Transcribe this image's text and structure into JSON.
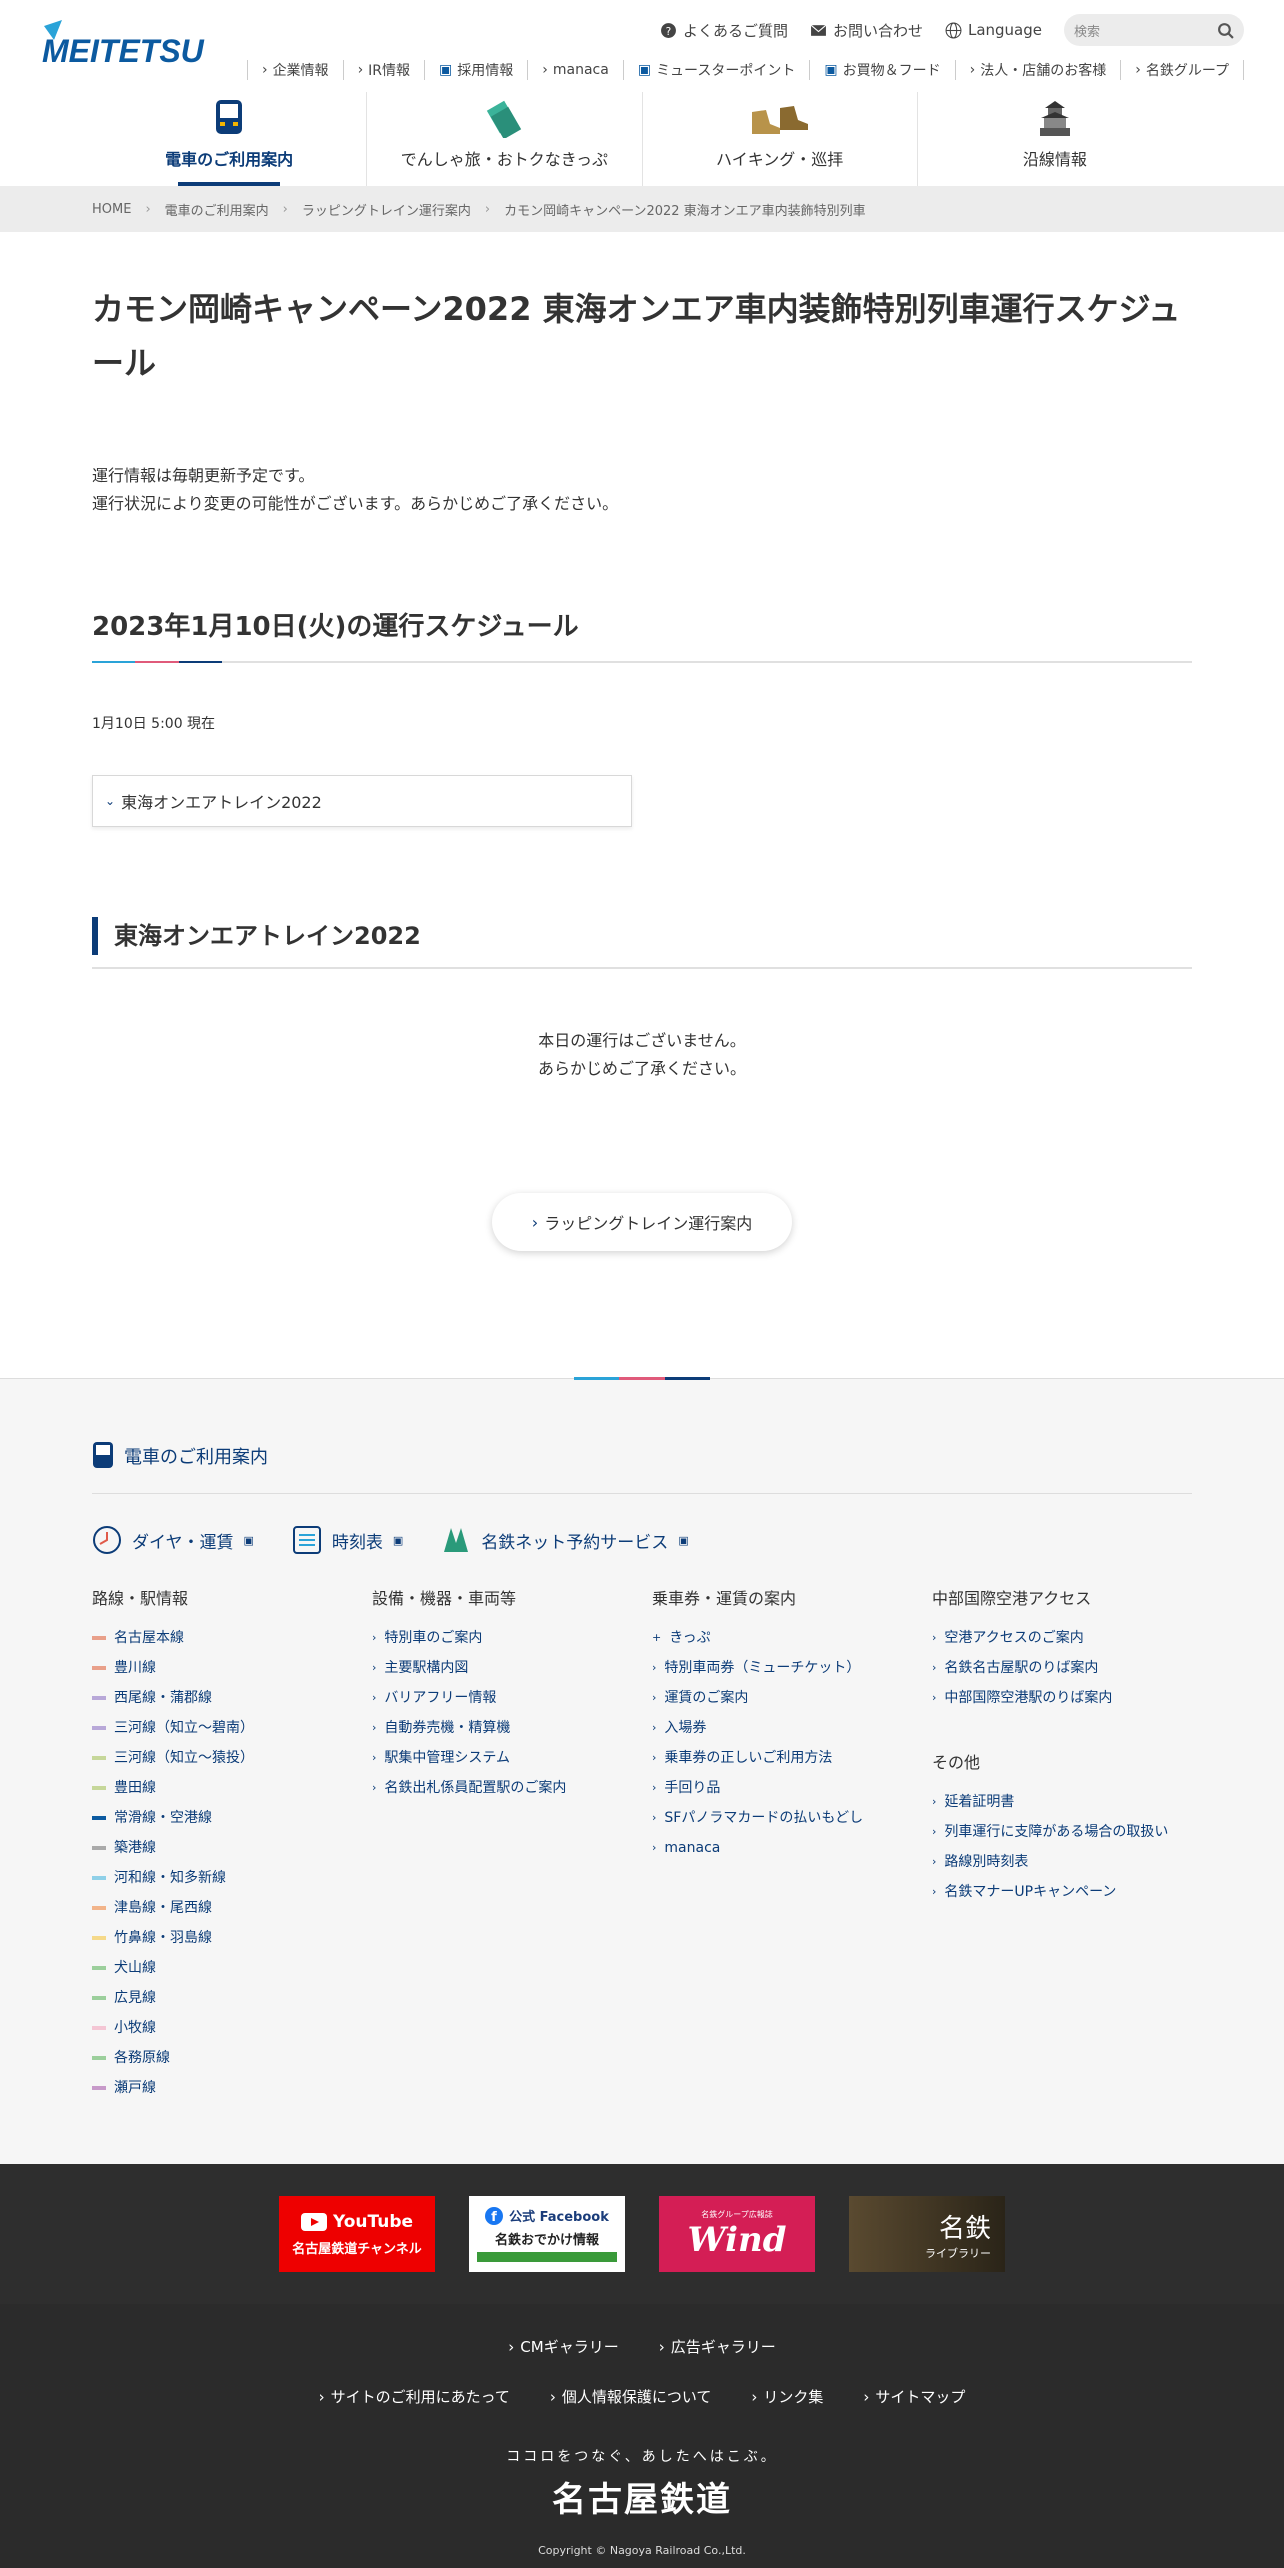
{
  "header": {
    "logo": "MEITETSU",
    "util": {
      "faq": "よくあるご質問",
      "contact": "お問い合わせ",
      "language": "Language",
      "search_placeholder": "検索"
    },
    "subnav": [
      "企業情報",
      "IR情報",
      "採用情報",
      "manaca",
      "ミュースターポイント",
      "お買物＆フード",
      "法人・店舗のお客様",
      "名鉄グループ"
    ],
    "gnav": [
      "電車のご利用案内",
      "でんしゃ旅・おトクなきっぷ",
      "ハイキング・巡拝",
      "沿線情報"
    ]
  },
  "breadcrumb": [
    "HOME",
    "電車のご利用案内",
    "ラッピングトレイン運行案内",
    "カモン岡崎キャンペーン2022 東海オンエア車内装飾特別列車"
  ],
  "main": {
    "title": "カモン岡崎キャンペーン2022 東海オンエア車内装飾特別列車運行スケジュール",
    "note1": "運行情報は毎朝更新予定です。",
    "note2": "運行状況により変更の可能性がございます。あらかじめご了承ください。",
    "schedule_heading": "2023年1月10日(火)の運行スケジュール",
    "status": "1月10日 5:00 現在",
    "accordion": "東海オンエアトレイン2022",
    "train_heading": "東海オンエアトレイン2022",
    "empty1": "本日の運行はございません。",
    "empty2": "あらかじめご了承ください。",
    "back_button": "ラッピングトレイン運行案内"
  },
  "footer": {
    "heading": "電車のご利用案内",
    "quick": [
      "ダイヤ・運賃",
      "時刻表",
      "名鉄ネット予約サービス"
    ],
    "col1": {
      "title": "路線・駅情報",
      "items": [
        [
          "名古屋本線",
          "#e9a08a"
        ],
        [
          "豊川線",
          "#e9a08a"
        ],
        [
          "西尾線・蒲郡線",
          "#b8a8d8"
        ],
        [
          "三河線（知立〜碧南）",
          "#b8a8d8"
        ],
        [
          "三河線（知立〜猿投）",
          "#c6d79a"
        ],
        [
          "豊田線",
          "#c6d79a"
        ],
        [
          "常滑線・空港線",
          "#0c5aa0"
        ],
        [
          "築港線",
          "#aaaaaa"
        ],
        [
          "河和線・知多新線",
          "#8fd0e8"
        ],
        [
          "津島線・尾西線",
          "#f2b48a"
        ],
        [
          "竹鼻線・羽島線",
          "#f5d98a"
        ],
        [
          "犬山線",
          "#9ccf9c"
        ],
        [
          "広見線",
          "#9ccf9c"
        ],
        [
          "小牧線",
          "#f4c6d4"
        ],
        [
          "各務原線",
          "#9ccf9c"
        ],
        [
          "瀬戸線",
          "#c79ac9"
        ]
      ]
    },
    "col2": {
      "title": "設備・機器・車両等",
      "items": [
        "特別車のご案内",
        "主要駅構内図",
        "バリアフリー情報",
        "自動券売機・精算機",
        "駅集中管理システム",
        "名鉄出札係員配置駅のご案内"
      ]
    },
    "col3": {
      "title": "乗車券・運賃の案内",
      "items": [
        "きっぷ",
        "特別車両券（ミューチケット）",
        "運賃のご案内",
        "入場券",
        "乗車券の正しいご利用方法",
        "手回り品",
        "SFパノラマカードの払いもどし",
        "manaca"
      ]
    },
    "col4": {
      "title": "中部国際空港アクセス",
      "items": [
        "空港アクセスのご案内",
        "名鉄名古屋駅のりば案内",
        "中部国際空港駅のりば案内"
      ],
      "title2": "その他",
      "items2": [
        "延着証明書",
        "列車運行に支障がある場合の取扱い",
        "路線別時刻表",
        "名鉄マナーUPキャンペーン"
      ]
    }
  },
  "banners": {
    "youtube": "YouTube",
    "youtube_sub": "名古屋鉄道チャンネル",
    "fb": "公式 Facebook",
    "fb_sub": "名鉄おでかけ情報",
    "wind": "Wind",
    "wind_top": "名鉄グループ広報誌",
    "lib": "名鉄",
    "lib_sub": "ライブラリー"
  },
  "bottom": {
    "links1": [
      "CMギャラリー",
      "広告ギャラリー"
    ],
    "links2": [
      "サイトのご利用にあたって",
      "個人情報保護について",
      "リンク集",
      "サイトマップ"
    ],
    "tagline": "ココロをつなぐ、あしたへはこぶ。",
    "corp": "名古屋鉄道",
    "copyright": "Copyright © Nagoya Railroad Co.,Ltd."
  }
}
